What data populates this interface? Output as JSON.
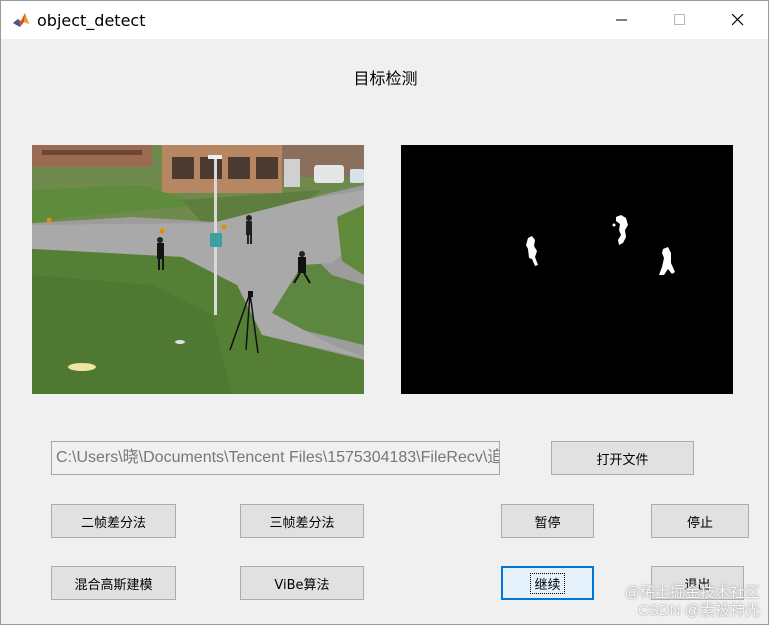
{
  "window": {
    "title": "object_detect",
    "minimize_icon": "minimize-icon",
    "maximize_icon": "maximize-icon",
    "close_icon": "close-icon"
  },
  "heading": "目标检测",
  "file_path": "C:\\Users\\晓\\Documents\\Tencent Files\\1575304183\\FileRecv\\追",
  "buttons": {
    "open_file": "打开文件",
    "two_frame_diff": "二帧差分法",
    "three_frame_diff": "三帧差分法",
    "pause": "暂停",
    "stop": "停止",
    "gmm": "混合高斯建模",
    "vibe": "ViBe算法",
    "resume": "继续",
    "exit": "退出"
  },
  "watermark": {
    "line1": "@稀土掘金技术社区",
    "line2": "CSDN @素被神光"
  },
  "colors": {
    "accent": "#0078d7",
    "button_face": "#e1e1e1",
    "window_bg": "#f0f0f0"
  }
}
